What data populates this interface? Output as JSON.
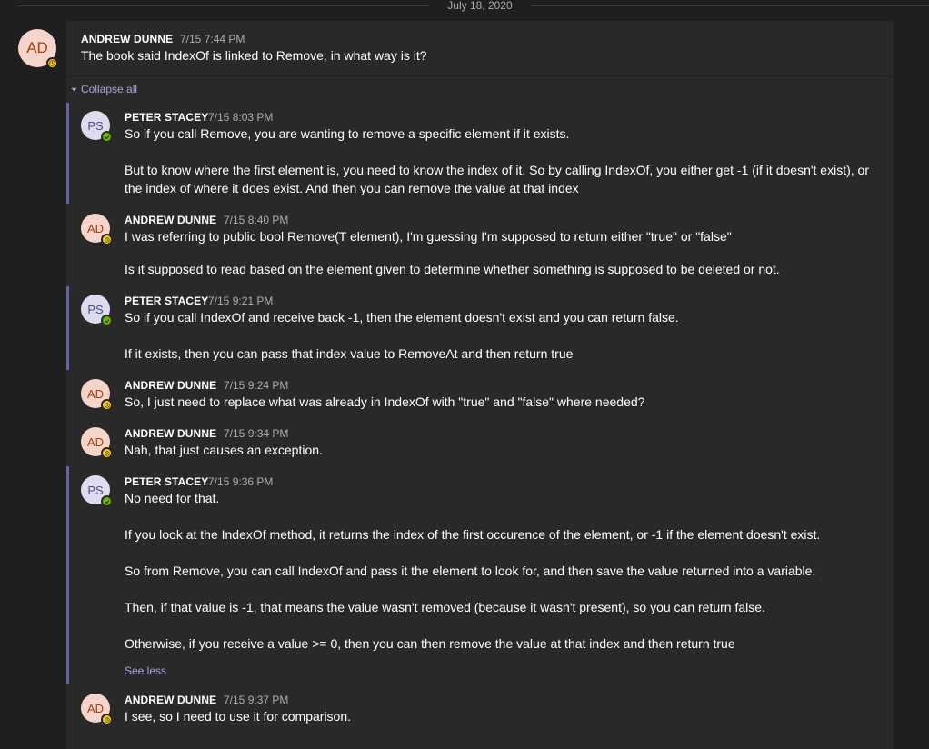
{
  "date_divider": "July 18, 2020",
  "root": {
    "avatar": "AD",
    "sender": "ANDREW DUNNE",
    "time": "7/15 7:44 PM",
    "text": "The book said IndexOf is linked to Remove, in what way is it?",
    "presence": "away"
  },
  "thread": {
    "collapse_label": "Collapse all",
    "see_less_label": "See less",
    "replies": [
      {
        "avatar": "PS",
        "sender": "PETER STACEY",
        "time": "7/15 8:03 PM",
        "presence": "available",
        "paragraphs": [
          "So if you call Remove, you are wanting to remove a specific element if it exists.",
          "But to know where the first element is, you need to know the index of it. So by calling IndexOf, you either get -1 (if it doesn't exist), or",
          "the index of where it does exist. And then you can remove the value at that index"
        ]
      },
      {
        "avatar": "AD",
        "sender": "ANDREW DUNNE",
        "time": "7/15 8:40 PM",
        "presence": "away",
        "paragraphs": [
          "I was referring to public bool Remove(T element), I'm guessing I'm supposed to return either \"true\" or \"false\"",
          "Is it supposed to read based on the element given to determine whether something is supposed to be deleted or not."
        ]
      },
      {
        "avatar": "PS",
        "sender": "PETER STACEY",
        "time": "7/15 9:21 PM",
        "presence": "available",
        "paragraphs": [
          "So if you call IndexOf and receive back -1, then the element doesn't exist and you can return false.",
          "If it exists, then you can pass that index value to RemoveAt and then return true"
        ]
      },
      {
        "avatar": "AD",
        "sender": "ANDREW DUNNE",
        "time": "7/15 9:24 PM",
        "presence": "away",
        "paragraphs": [
          "So, I just need to replace what was already in IndexOf with \"true\" and \"false\" where needed?"
        ]
      },
      {
        "avatar": "AD",
        "sender": "ANDREW DUNNE",
        "time": "7/15 9:34 PM",
        "presence": "away",
        "paragraphs": [
          "Nah, that just causes an exception."
        ]
      },
      {
        "avatar": "PS",
        "sender": "PETER STACEY",
        "time": "7/15 9:36 PM",
        "presence": "available",
        "paragraphs": [
          "No need for that.",
          "If you look at the IndexOf method, it returns the index of the first occurence of the element, or -1 if the element doesn't exist.",
          "So from Remove, you can call IndexOf and pass it the element to look for, and then save the value returned into a variable.",
          "Then, if that value is -1, that means the value wasn't removed (because it wasn't present), so you can return false.",
          "Otherwise, if you receive a value >= 0, then you can then remove the value at that index and then return true"
        ]
      },
      {
        "avatar": "AD",
        "sender": "ANDREW DUNNE",
        "time": "7/15 9:37 PM",
        "presence": "away",
        "paragraphs": [
          "I see, so I need to use it for comparison."
        ]
      }
    ]
  },
  "colors": {
    "accent": "#6264a7",
    "link": "#a6a7dc",
    "away": "#f8d22a",
    "available": "#6bb700"
  }
}
